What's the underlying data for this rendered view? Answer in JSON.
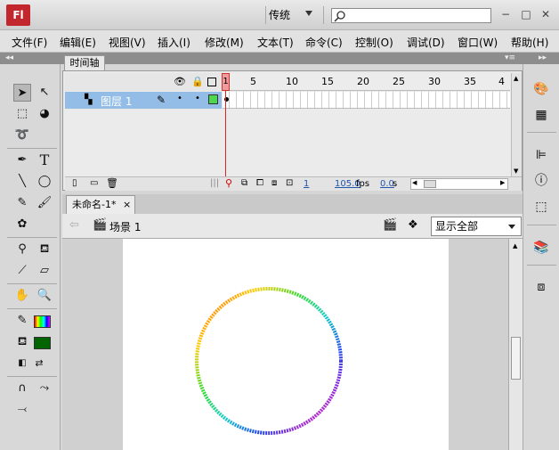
{
  "app": {
    "logo": "Fl",
    "workspace": "传统",
    "search_placeholder": ""
  },
  "window_controls": {
    "minimize": "−",
    "restore": "□",
    "close": "✕"
  },
  "menus": [
    "文件(F)",
    "编辑(E)",
    "视图(V)",
    "插入(I)",
    "修改(M)",
    "文本(T)",
    "命令(C)",
    "控制(O)",
    "调试(D)",
    "窗口(W)",
    "帮助(H)"
  ],
  "timeline": {
    "tab_label": "时间轴",
    "layer_name": "图层 1",
    "frame_numbers": [
      "1",
      "5",
      "10",
      "15",
      "20",
      "25",
      "30",
      "35",
      "4"
    ],
    "current_frame": "1",
    "fps": "105.0",
    "fps_unit": "fps",
    "elapsed": "0.0",
    "elapsed_unit": "s"
  },
  "document": {
    "tab_label": "未命名-1*",
    "close": "×",
    "scene": "场景 1",
    "zoom": "显示全部"
  },
  "colors": {
    "stroke": "#000000",
    "fill": "#006400",
    "layer_highlight": "#93bde6",
    "playhead": "#dd2222"
  },
  "icons": {
    "tools": [
      "selection-icon",
      "subselection-icon",
      "free-transform-icon",
      "3d-rotation-icon",
      "lasso-icon",
      "pen-icon",
      "text-icon",
      "line-icon",
      "oval-icon",
      "pencil-icon",
      "brush-icon",
      "deco-icon",
      "bone-icon",
      "paint-bucket-icon",
      "eyedropper-icon",
      "eraser-icon",
      "hand-icon",
      "zoom-icon",
      "stroke-color-icon",
      "fill-color-icon",
      "default-colors-icon",
      "swap-colors-icon",
      "snap-icon",
      "smooth-icon",
      "straighten-icon"
    ],
    "right_panel": [
      "color-panel-icon",
      "swatches-panel-icon",
      "align-panel-icon",
      "info-panel-icon",
      "transform-panel-icon",
      "library-panel-icon",
      "properties-panel-icon"
    ]
  }
}
